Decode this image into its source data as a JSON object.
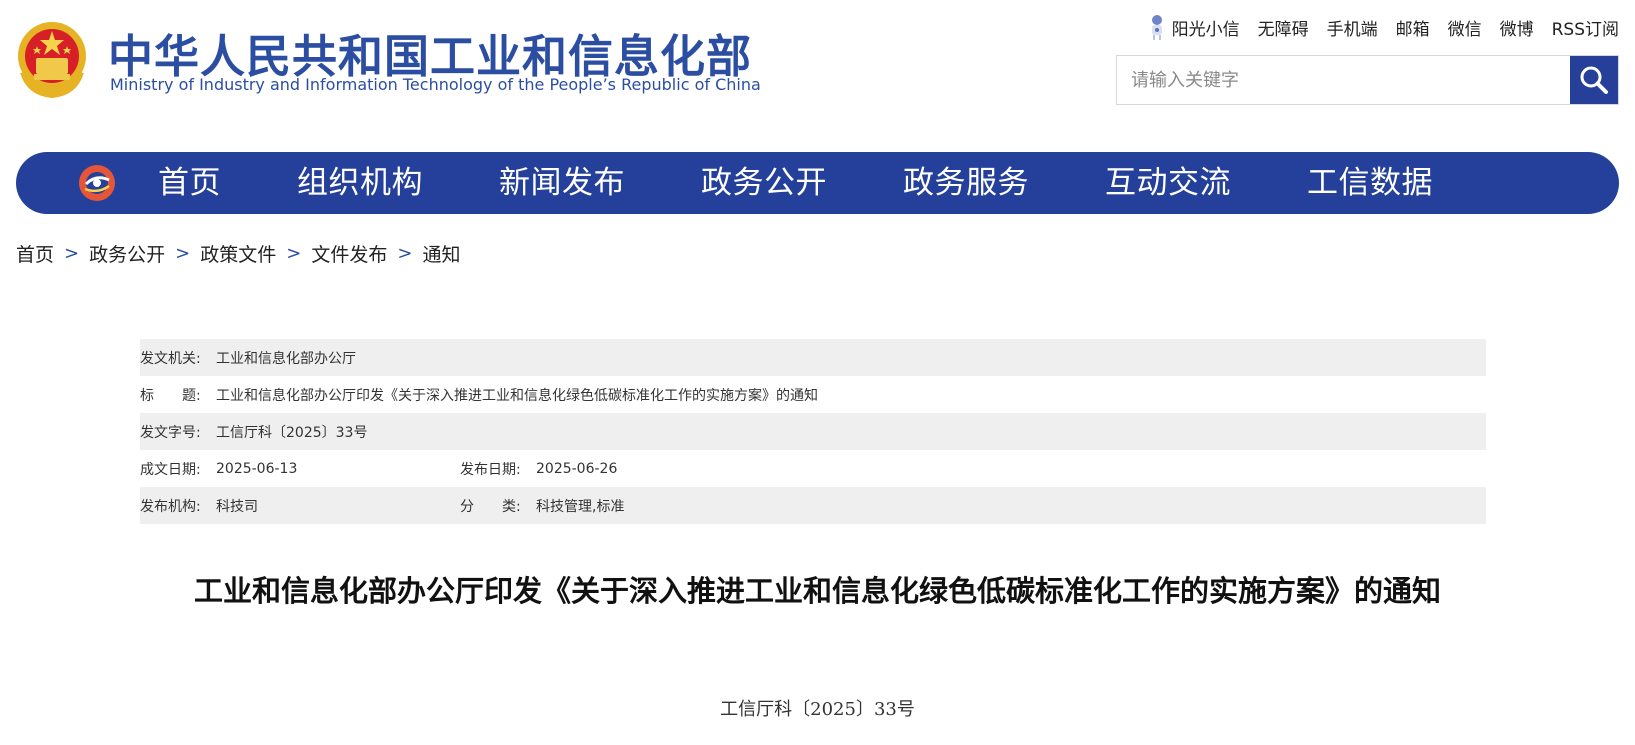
{
  "header": {
    "title_cn": "中华人民共和国工业和信息化部",
    "title_en": "Ministry of Industry and Information Technology of the People’s Republic of China",
    "logo_icon": "national-emblem-icon"
  },
  "top_links": [
    {
      "label": "阳光小信",
      "icon": "robot-icon"
    },
    {
      "label": "无障碍"
    },
    {
      "label": "手机端"
    },
    {
      "label": "邮箱"
    },
    {
      "label": "微信"
    },
    {
      "label": "微博"
    },
    {
      "label": "RSS订阅"
    }
  ],
  "search": {
    "placeholder": "请输入关键字",
    "button_icon": "search-icon"
  },
  "nav": {
    "logo_icon": "nav-logo-icon",
    "items": [
      "首页",
      "组织机构",
      "新闻发布",
      "政务公开",
      "政务服务",
      "互动交流",
      "工信数据"
    ]
  },
  "breadcrumb": [
    "首页",
    "政务公开",
    "政策文件",
    "文件发布",
    "通知"
  ],
  "meta": {
    "issuing_agency_label": "发文机关:",
    "issuing_agency": "工业和信息化部办公厅",
    "title_label": "标　　题:",
    "title": "工业和信息化部办公厅印发《关于深入推进工业和信息化绿色低碳标准化工作的实施方案》的通知",
    "doc_no_label": "发文字号:",
    "doc_no": "工信厅科〔2025〕33号",
    "created_label": "成文日期:",
    "created": "2025-06-13",
    "published_label": "发布日期:",
    "published": "2025-06-26",
    "publisher_label": "发布机构:",
    "publisher": "科技司",
    "category_label": "分　　类:",
    "category": "科技管理,标准"
  },
  "document": {
    "title": "工业和信息化部办公厅印发《关于深入推进工业和信息化绿色低碳标准化工作的实施方案》的通知",
    "number": "工信厅科〔2025〕33号"
  },
  "colors": {
    "brand_blue": "#24409a",
    "title_blue": "#2b4ea2",
    "row_gray": "#efefef"
  }
}
